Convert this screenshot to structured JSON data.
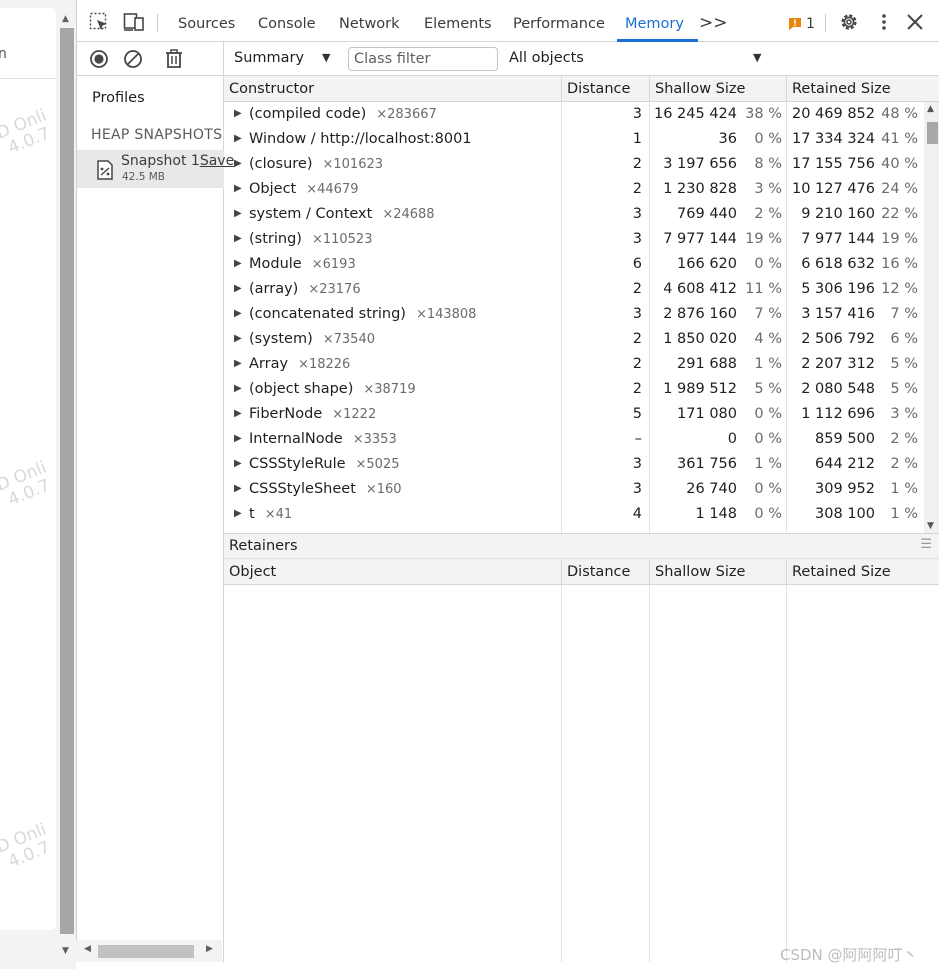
{
  "page_strip": {
    "glyph": "n",
    "watermarks": [
      "D Onli\n4.0.7",
      "D Onli\n4.0.7",
      "D Onli\n4.0.7"
    ]
  },
  "toolbar": {
    "tabs": [
      "Sources",
      "Console",
      "Network",
      "Elements",
      "Performance",
      "Memory"
    ],
    "active_tab": "Memory",
    "more_tabs": ">>",
    "issues_count": "1",
    "icons": [
      "inspect-element-icon",
      "device-toolbar-icon",
      "issue-flag-icon",
      "settings-gear-icon",
      "more-vertical-icon",
      "close-icon"
    ],
    "accent_color": "#1a6fd4"
  },
  "sidebar": {
    "title": "Profiles",
    "heading": "HEAP SNAPSHOTS",
    "snapshot": {
      "name": "Snapshot 1",
      "save": "Save",
      "size": "42.5 MB"
    },
    "icons": [
      "record-icon",
      "clear-icon",
      "trash-icon"
    ]
  },
  "filterbar": {
    "view": "Summary",
    "class_filter_placeholder": "Class filter",
    "objects": "All objects"
  },
  "constructor_table": {
    "columns": [
      "Constructor",
      "Distance",
      "Shallow Size",
      "Retained Size"
    ],
    "rows": [
      {
        "name": "(compiled code)",
        "count": "×283667",
        "distance": "3",
        "shallow": "16 245 424",
        "shallow_pct": "38 %",
        "retained": "20 469 852",
        "retained_pct": "48 %"
      },
      {
        "name": "Window / http://localhost:8001",
        "count": "",
        "distance": "1",
        "shallow": "36",
        "shallow_pct": "0 %",
        "retained": "17 334 324",
        "retained_pct": "41 %"
      },
      {
        "name": "(closure)",
        "count": "×101623",
        "distance": "2",
        "shallow": "3 197 656",
        "shallow_pct": "8 %",
        "retained": "17 155 756",
        "retained_pct": "40 %"
      },
      {
        "name": "Object",
        "count": "×44679",
        "distance": "2",
        "shallow": "1 230 828",
        "shallow_pct": "3 %",
        "retained": "10 127 476",
        "retained_pct": "24 %"
      },
      {
        "name": "system / Context",
        "count": "×24688",
        "distance": "3",
        "shallow": "769 440",
        "shallow_pct": "2 %",
        "retained": "9 210 160",
        "retained_pct": "22 %"
      },
      {
        "name": "(string)",
        "count": "×110523",
        "distance": "3",
        "shallow": "7 977 144",
        "shallow_pct": "19 %",
        "retained": "7 977 144",
        "retained_pct": "19 %"
      },
      {
        "name": "Module",
        "count": "×6193",
        "distance": "6",
        "shallow": "166 620",
        "shallow_pct": "0 %",
        "retained": "6 618 632",
        "retained_pct": "16 %"
      },
      {
        "name": "(array)",
        "count": "×23176",
        "distance": "2",
        "shallow": "4 608 412",
        "shallow_pct": "11 %",
        "retained": "5 306 196",
        "retained_pct": "12 %"
      },
      {
        "name": "(concatenated string)",
        "count": "×143808",
        "distance": "3",
        "shallow": "2 876 160",
        "shallow_pct": "7 %",
        "retained": "3 157 416",
        "retained_pct": "7 %"
      },
      {
        "name": "(system)",
        "count": "×73540",
        "distance": "2",
        "shallow": "1 850 020",
        "shallow_pct": "4 %",
        "retained": "2 506 792",
        "retained_pct": "6 %"
      },
      {
        "name": "Array",
        "count": "×18226",
        "distance": "2",
        "shallow": "291 688",
        "shallow_pct": "1 %",
        "retained": "2 207 312",
        "retained_pct": "5 %"
      },
      {
        "name": "(object shape)",
        "count": "×38719",
        "distance": "2",
        "shallow": "1 989 512",
        "shallow_pct": "5 %",
        "retained": "2 080 548",
        "retained_pct": "5 %"
      },
      {
        "name": "FiberNode",
        "count": "×1222",
        "distance": "5",
        "shallow": "171 080",
        "shallow_pct": "0 %",
        "retained": "1 112 696",
        "retained_pct": "3 %"
      },
      {
        "name": "InternalNode",
        "count": "×3353",
        "distance": "–",
        "shallow": "0",
        "shallow_pct": "0 %",
        "retained": "859 500",
        "retained_pct": "2 %"
      },
      {
        "name": "CSSStyleRule",
        "count": "×5025",
        "distance": "3",
        "shallow": "361 756",
        "shallow_pct": "1 %",
        "retained": "644 212",
        "retained_pct": "2 %"
      },
      {
        "name": "CSSStyleSheet",
        "count": "×160",
        "distance": "3",
        "shallow": "26 740",
        "shallow_pct": "0 %",
        "retained": "309 952",
        "retained_pct": "1 %"
      },
      {
        "name": "t",
        "count": "×41",
        "distance": "4",
        "shallow": "1 148",
        "shallow_pct": "0 %",
        "retained": "308 100",
        "retained_pct": "1 %"
      }
    ]
  },
  "retainers": {
    "title": "Retainers",
    "columns": [
      "Object",
      "Distance",
      "Shallow Size",
      "Retained Size"
    ]
  },
  "watermark_csdn": "CSDN @阿阿阿叮丶"
}
